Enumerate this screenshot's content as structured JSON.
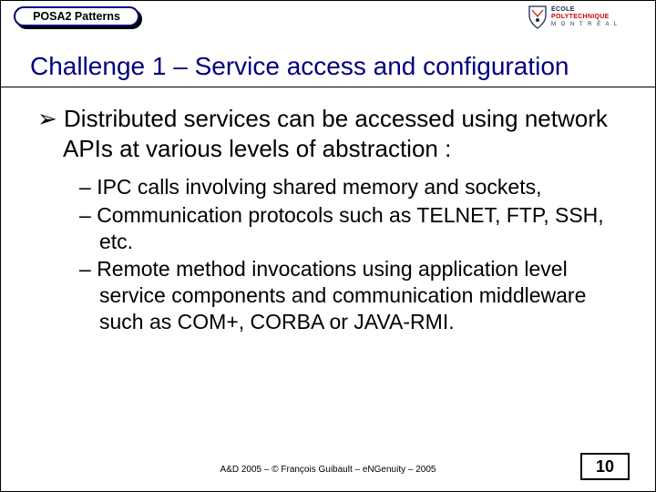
{
  "header": {
    "badge": "POSA2 Patterns",
    "logo": {
      "line1": "ÉCOLE",
      "line2": "POLYTECHNIQUE",
      "line3": "M O N T R É A L"
    }
  },
  "title": "Challenge 1 – Service access and configuration",
  "content": {
    "bullet1": "Distributed services can be accessed using network APIs at various levels of abstraction :",
    "sub": [
      "IPC calls involving shared memory and sockets,",
      "Communication protocols such as TELNET, FTP, SSH, etc.",
      "Remote method invocations using application level service components and communication middleware such as COM+, CORBA or JAVA-RMI."
    ]
  },
  "footer": {
    "text": "A&D 2005 – ©  François Guibault – eNGenuity – 2005",
    "page": "10"
  }
}
